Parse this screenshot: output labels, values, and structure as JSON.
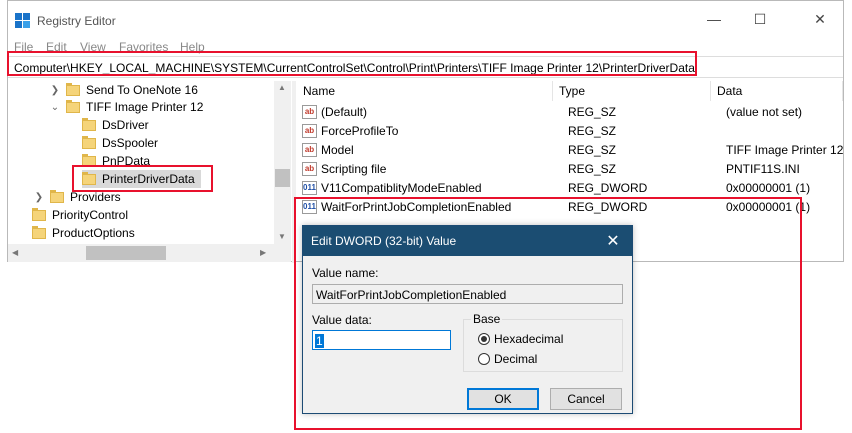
{
  "window": {
    "title": "Registry Editor",
    "controls": {
      "minimize": "—",
      "maximize": "☐",
      "close": "✕"
    }
  },
  "menu": [
    "File",
    "Edit",
    "View",
    "Favorites",
    "Help"
  ],
  "address": "Computer\\HKEY_LOCAL_MACHINE\\SYSTEM\\CurrentControlSet\\Control\\Print\\Printers\\TIFF Image Printer 12\\PrinterDriverData",
  "tree": [
    {
      "label": "Send To OneNote 16"
    },
    {
      "label": "TIFF Image Printer 12"
    },
    {
      "label": "DsDriver"
    },
    {
      "label": "DsSpooler"
    },
    {
      "label": "PnPData"
    },
    {
      "label": "PrinterDriverData"
    },
    {
      "label": "Providers"
    },
    {
      "label": "PriorityControl"
    },
    {
      "label": "ProductOptions"
    }
  ],
  "list": {
    "headers": {
      "name": "Name",
      "type": "Type",
      "data": "Data"
    },
    "rows": [
      {
        "icon": "ab",
        "name": "(Default)",
        "type": "REG_SZ",
        "data": "(value not set)"
      },
      {
        "icon": "ab",
        "name": "ForceProfileTo",
        "type": "REG_SZ",
        "data": ""
      },
      {
        "icon": "ab",
        "name": "Model",
        "type": "REG_SZ",
        "data": "TIFF Image Printer 12"
      },
      {
        "icon": "ab",
        "name": "Scripting file",
        "type": "REG_SZ",
        "data": "PNTIF11S.INI"
      },
      {
        "icon": "011",
        "name": "V11CompatiblityModeEnabled",
        "type": "REG_DWORD",
        "data": "0x00000001 (1)"
      },
      {
        "icon": "011",
        "name": "WaitForPrintJobCompletionEnabled",
        "type": "REG_DWORD",
        "data": "0x00000001 (1)"
      }
    ]
  },
  "dialog": {
    "title": "Edit DWORD (32-bit) Value",
    "value_name_label": "Value name:",
    "value_name": "WaitForPrintJobCompletionEnabled",
    "value_data_label": "Value data:",
    "value_data": "1",
    "base_label": "Base",
    "hex_label": "Hexadecimal",
    "dec_label": "Decimal",
    "ok": "OK",
    "cancel": "Cancel",
    "close": "✕"
  },
  "colors": {
    "dialog_title": "#1b4d72",
    "highlight": "#e8112d",
    "accent": "#0078d7"
  }
}
